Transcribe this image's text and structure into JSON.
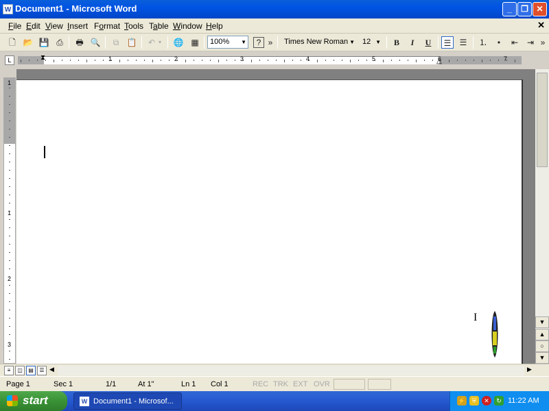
{
  "window": {
    "title": "Document1 - Microsoft Word",
    "app_icon": "W"
  },
  "caption_buttons": {
    "minimize": "_",
    "restore": "❐",
    "close": "✕"
  },
  "menubar": {
    "items": [
      {
        "label": "File",
        "hotkey": "F"
      },
      {
        "label": "Edit",
        "hotkey": "E"
      },
      {
        "label": "View",
        "hotkey": "V"
      },
      {
        "label": "Insert",
        "hotkey": "I"
      },
      {
        "label": "Format",
        "hotkey": "o"
      },
      {
        "label": "Tools",
        "hotkey": "T"
      },
      {
        "label": "Table",
        "hotkey": "a"
      },
      {
        "label": "Window",
        "hotkey": "W"
      },
      {
        "label": "Help",
        "hotkey": "H"
      }
    ],
    "doc_close": "✕"
  },
  "toolbar": {
    "zoom": "100%",
    "help_icon": "?",
    "overflow": "»",
    "font_name": "Times New Roman",
    "font_size": "12",
    "bold": "B",
    "italic": "I",
    "underline": "U"
  },
  "ruler": {
    "tab_selector": "L",
    "numbers": [
      "1",
      "2",
      "3",
      "4",
      "5",
      "6",
      "7"
    ]
  },
  "vruler": {
    "numbers": [
      "1",
      "1",
      "2",
      "3"
    ]
  },
  "statusbar": {
    "page": "Page 1",
    "sec": "Sec 1",
    "pages": "1/1",
    "at": "At 1\"",
    "ln": "Ln 1",
    "col": "Col 1",
    "rec": "REC",
    "trk": "TRK",
    "ext": "EXT",
    "ovr": "OVR"
  },
  "taskbar": {
    "start_label": "start",
    "task_label": "Document1 - Microsof...",
    "clock": "11:22 AM"
  },
  "colors": {
    "titlebar": "#0054e3",
    "taskbar": "#2558d0",
    "start": "#3a9236",
    "close": "#e0502c"
  }
}
